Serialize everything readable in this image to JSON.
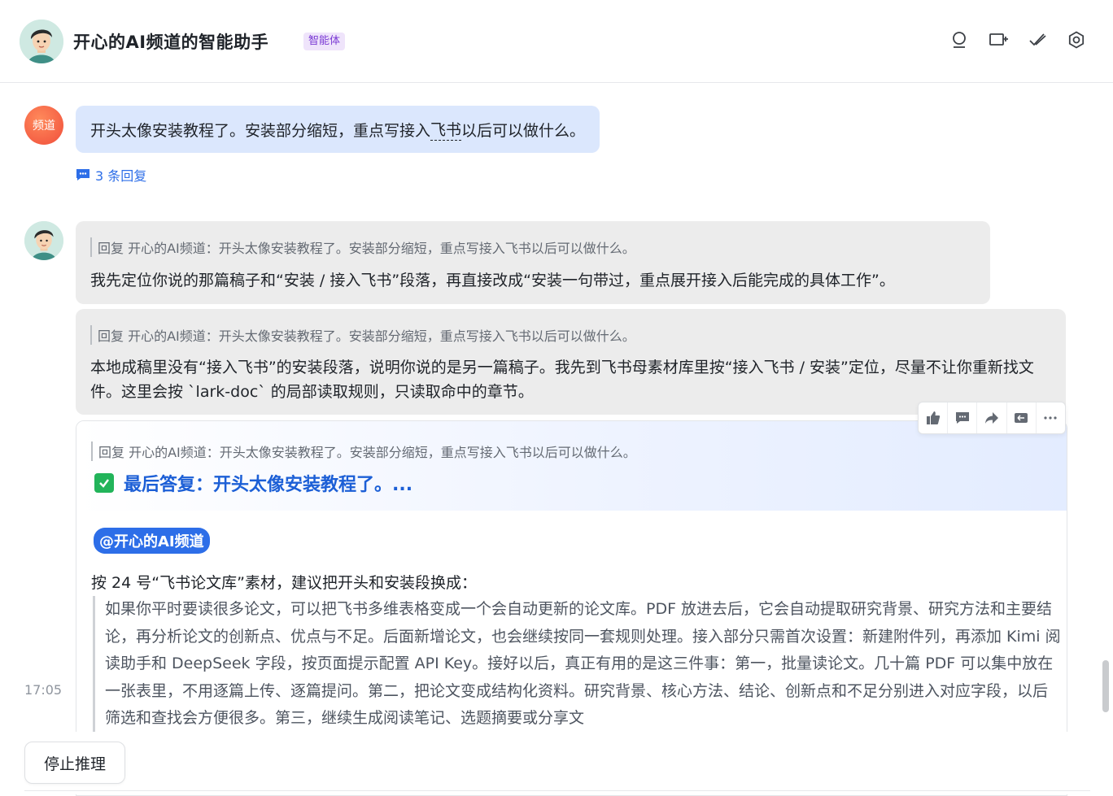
{
  "header": {
    "title": "开心的AI频道的智能助手",
    "badge": "智能体",
    "icons": [
      "search-icon",
      "new-chat-icon",
      "edit-check-icon",
      "gear-icon"
    ]
  },
  "user_message": {
    "avatar_text": "频道",
    "text_before": "开头太像安装教程了。安装部分缩短，重点写接入",
    "text_underlined": "飞书",
    "text_after": "以后可以做什么。",
    "replies_label": "3 条回复"
  },
  "bot_messages": [
    {
      "quote": "回复 开心的AI频道：开头太像安装教程了。安装部分缩短，重点写接入飞书以后可以做什么。",
      "text": "我先定位你说的那篇稿子和“安装 / 接入飞书”段落，再直接改成“安装一句带过，重点展开接入后能完成的具体工作”。"
    },
    {
      "quote": "回复 开心的AI频道：开头太像安装教程了。安装部分缩短，重点写接入飞书以后可以做什么。",
      "text": "本地成稿里没有“接入飞书”的安装段落，说明你说的是另一篇稿子。我先到飞书母素材库里按“接入飞书 / 安装”定位，尽量不让你重新找文件。这里会按 `lark-doc` 的局部读取规则，只读取命中的章节。"
    }
  ],
  "final_card": {
    "quote": "回复 开心的AI频道：开头太像安装教程了。安装部分缩短，重点写接入飞书以后可以做什么。",
    "title": "最后答复：开头太像安装教程了。...",
    "mention": "@开心的AI频道",
    "intro": "按 24 号“飞书论文库”素材，建议把开头和安装段换成：",
    "block": "如果你平时要读很多论文，可以把飞书多维表格变成一个会自动更新的论文库。PDF 放进去后，它会自动提取研究背景、研究方法和主要结论，再分析论文的创新点、优点与不足。后面新增论文，也会继续按同一套规则处理。接入部分只需首次设置：新建附件列，再添加 Kimi 阅读助手和 DeepSeek 字段，按页面提示配置 API Key。接好以后，真正有用的是这三件事：第一，批量读论文。几十篇 PDF 可以集中放在一张表里，不用逐篇上传、逐篇提问。第二，把论文变成结构化资料。研究背景、核心方法、结论、创新点和不足分别进入对应字段，以后筛选和查找会方便很多。第三，继续生成阅读笔记、选题摘要或分享文"
  },
  "toolbar": [
    "thumbs-up-icon",
    "comment-icon",
    "forward-icon",
    "quote-icon",
    "more-icon"
  ],
  "timestamp": "17:05",
  "stop_button": "停止推理"
}
